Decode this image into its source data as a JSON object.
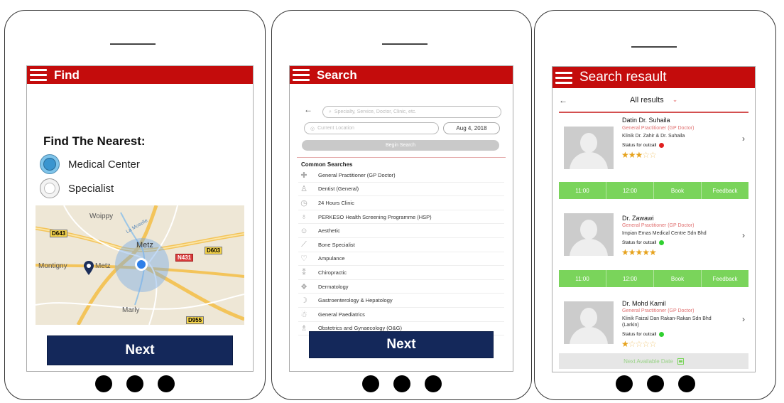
{
  "find_screen": {
    "title": "Find",
    "heading": "Find The Nearest:",
    "options": [
      {
        "label": "Medical Center",
        "selected": true
      },
      {
        "label": "Specialist",
        "selected": false
      }
    ],
    "map": {
      "places": [
        "Woippy",
        "Metz",
        "Montigny",
        "Metz",
        "Marly"
      ],
      "roads": [
        "D643",
        "D603",
        "N431",
        "D955"
      ],
      "river": "La Moselle"
    },
    "next_label": "Next"
  },
  "search_screen": {
    "title": "Search",
    "search_placeholder": "Specialty, Service, Doctor, Clinic, etc.",
    "location_placeholder": "Current Location",
    "date": "Aug 4, 2018",
    "begin_label": "Begin Search",
    "common_title": "Common Searches",
    "common_items": [
      {
        "label": "General Practitioner (GP Doctor)",
        "icon": "cross-icon"
      },
      {
        "label": "Dentist (General)",
        "icon": "tooth-icon"
      },
      {
        "label": "24 Hours Clinic",
        "icon": "clock-icon"
      },
      {
        "label": "PERKESO Health Screening Programme (HSP)",
        "icon": "pin-icon"
      },
      {
        "label": "Aesthetic",
        "icon": "face-icon"
      },
      {
        "label": "Bone Specialist",
        "icon": "bone-icon"
      },
      {
        "label": "Ampulance",
        "icon": "heart-icon"
      },
      {
        "label": "Chiropractic",
        "icon": "spine-icon"
      },
      {
        "label": "Dermatology",
        "icon": "skin-icon"
      },
      {
        "label": "Gastroenterology & Hepatology",
        "icon": "stomach-icon"
      },
      {
        "label": "General Paediatrics",
        "icon": "baby-icon"
      },
      {
        "label": "Obstetrics and Gynaecology (O&G)",
        "icon": "mother-icon"
      }
    ],
    "next_label": "Next"
  },
  "results_screen": {
    "title": "Search resault",
    "filter_label": "All results",
    "status_label": "Status for outcall",
    "doctors": [
      {
        "name": "Datin Dr. Suhaila",
        "role": "General Practitioner (GP Doctor)",
        "clinic": "Klinik Dr. Zahir & Dr. Suhaila",
        "status_color": "#e02020",
        "rating": 3,
        "slots": [
          "11:00",
          "12:00",
          "Book",
          "Feedback"
        ]
      },
      {
        "name": "Dr. Zawawi",
        "role": "General Practitioner (GP Doctor)",
        "clinic": "Impian Emas Medical Centre Sdn Bhd",
        "status_color": "#30d030",
        "rating": 5,
        "slots": [
          "11:00",
          "12:00",
          "Book",
          "Feedback"
        ]
      },
      {
        "name": "Dr. Mohd Kamil",
        "role": "General Practitioner (GP Doctor)",
        "clinic": "Klinik Faizal Dan Rakan-Rakan Sdn Bhd (Larkin)",
        "status_color": "#30d030",
        "rating": 1
      }
    ],
    "next_available_label": "Next Available Date"
  },
  "colors": {
    "appbar": "#c40c0c",
    "next_button": "#14285a",
    "slot_bar": "#7ad45b"
  }
}
